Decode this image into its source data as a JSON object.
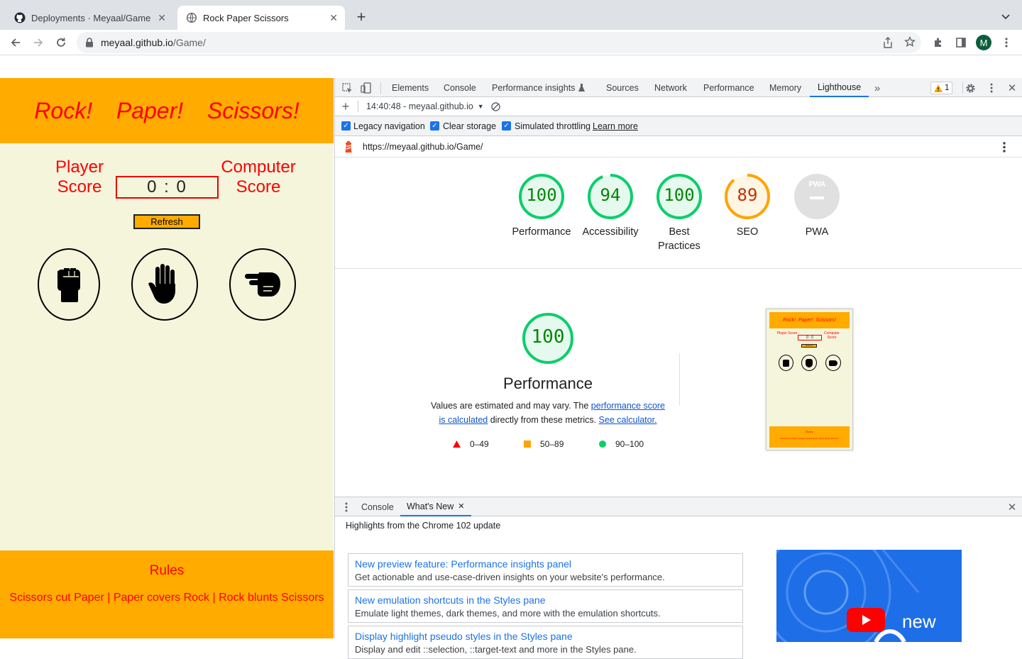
{
  "browser": {
    "tabs": [
      {
        "title": "Deployments · Meyaal/Game",
        "icon": "github-icon"
      },
      {
        "title": "Rock Paper Scissors",
        "icon": "globe-icon"
      }
    ],
    "url_host": "meyaal.github.io",
    "url_path": "/Game/",
    "profile_initial": "M"
  },
  "game": {
    "title": "Rock!  Paper!  Scissors!",
    "player_label_1": "Player",
    "player_label_2": "Score",
    "computer_label_1": "Computer",
    "computer_label_2": "Score",
    "score": "0 : 0",
    "refresh_label": "Refresh",
    "choices": [
      "rock",
      "paper",
      "scissors"
    ],
    "rules_title": "Rules",
    "rules_text": "Scissors cut Paper | Paper covers Rock | Rock blunts Scissors"
  },
  "devtools": {
    "tabs": [
      "Elements",
      "Console",
      "Performance insights",
      "Sources",
      "Network",
      "Performance",
      "Memory",
      "Lighthouse"
    ],
    "active_tab": "Lighthouse",
    "warning_count": "1",
    "report_label": "14:40:48 - meyaal.github.io",
    "options": [
      "Legacy navigation",
      "Clear storage",
      "Simulated throttling"
    ],
    "learn_more": "Learn more",
    "audited_url": "https://meyaal.github.io/Game/",
    "scores": [
      {
        "label": "Performance",
        "value": "100",
        "status": "pass"
      },
      {
        "label": "Accessibility",
        "value": "94",
        "status": "pass"
      },
      {
        "label": "Best Practices",
        "value": "100",
        "status": "pass"
      },
      {
        "label": "SEO",
        "value": "89",
        "status": "average"
      },
      {
        "label": "PWA",
        "value": "PWA",
        "status": "na"
      }
    ],
    "perf_score": "100",
    "perf_title": "Performance",
    "perf_desc_1": "Values are estimated and may vary. The ",
    "perf_link_1": "performance score is calculated",
    "perf_desc_2": " directly from these metrics. ",
    "perf_link_2": "See calculator.",
    "legend": [
      "0–49",
      "50–89",
      "90–100"
    ],
    "colors": {
      "pass": "#0cce6b",
      "average": "#ffa400",
      "fail": "#ff4e42",
      "pass_text": "#008800",
      "average_text": "#c33300"
    },
    "thumbnail": {
      "title": "Rock!  Paper!  Scissors!",
      "player": "Player Score",
      "computer": "Computer Score",
      "score": "0 : 0",
      "refresh": "Refresh",
      "rules": "Rules",
      "rules_text": "Scissors cut Paper | Paper covers Rock | Rock blunts Scissors"
    }
  },
  "drawer": {
    "tabs": [
      "Console",
      "What's New"
    ],
    "active_tab": "What's New",
    "heading": "Highlights from the Chrome 102 update",
    "items": [
      {
        "title": "New preview feature: Performance insights panel",
        "desc": "Get actionable and use-case-driven insights on your website's performance."
      },
      {
        "title": "New emulation shortcuts in the Styles pane",
        "desc": "Emulate light themes, dark themes, and more with the emulation shortcuts."
      },
      {
        "title": "Display highlight pseudo styles in the Styles pane",
        "desc": "Display and edit ::selection, ::target-text and more in the Styles pane."
      }
    ],
    "video_caption": "new"
  }
}
